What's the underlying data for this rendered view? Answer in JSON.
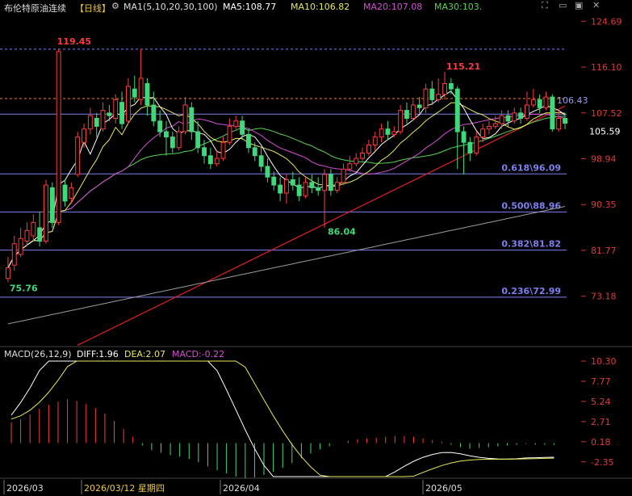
{
  "header": {
    "instrument": "布伦特原油连续",
    "period": "【日线】",
    "ma_label": "MA1(5,10,20,30,100)",
    "ma5": "MA5:108.77",
    "ma10": "MA10:106.82",
    "ma20": "MA20:107.08",
    "ma30": "MA30:103."
  },
  "macd_header": {
    "name": "MACD(26,12,9)",
    "diff": "DIFF:1.96",
    "dea": "DEA:2.07",
    "macd": "MACD:-0.22"
  },
  "colors": {
    "up": "#ff3b3b",
    "down": "#3fd87a",
    "ma5": "#ffffff",
    "ma10": "#e8e85a",
    "ma20": "#d44fd4",
    "ma30": "#55d455",
    "ma100": "#9a9a9a",
    "fib": "#7f7ff0",
    "trend": "#e02020",
    "dash": "#e08a2a"
  },
  "icons": [
    "settings-gear-icon",
    "expand-icon",
    "minimize-icon",
    "restore-icon",
    "close-icon"
  ],
  "chart_data": {
    "type": "candlestick",
    "price_axis": {
      "ticks": [
        "124.69",
        "116.10",
        "107.52",
        "98.94",
        "90.35",
        "81.77",
        "73.18"
      ],
      "current": "105.59",
      "current_ma": "106.43"
    },
    "fib_levels": [
      "0.618\\96.09",
      "0.500\\88.96",
      "0.382\\81.82",
      "0.236\\72.99"
    ],
    "price_labels": {
      "high1": "119.45",
      "high2": "115.21",
      "low1": "86.04",
      "low0": "75.76"
    },
    "dates": [
      "2026/03",
      "2026/03/12 星期四",
      "2026/04",
      "2026/05"
    ],
    "macd_axis": [
      "10.30",
      "7.77",
      "5.24",
      "2.71",
      "0.18",
      "-2.35"
    ],
    "candles": [
      [
        76.5,
        78.5,
        80.5,
        75.8
      ],
      [
        79,
        83,
        84.5,
        78
      ],
      [
        81,
        84,
        86,
        80.5
      ],
      [
        83.5,
        85.5,
        87,
        82.5
      ],
      [
        84.5,
        87,
        88.5,
        83.5
      ],
      [
        86,
        83.5,
        89,
        82.5
      ],
      [
        83.5,
        94,
        95,
        83
      ],
      [
        93.5,
        87,
        94.5,
        86
      ],
      [
        87,
        119,
        119.45,
        86.5
      ],
      [
        94,
        91,
        95,
        90
      ],
      [
        91.5,
        93.5,
        94.5,
        90.5
      ],
      [
        96,
        103,
        104,
        95.5
      ],
      [
        102,
        104.5,
        105.5,
        101
      ],
      [
        104.5,
        107,
        108.5,
        103.5
      ],
      [
        106.5,
        105,
        107.5,
        103
      ],
      [
        104.5,
        108,
        109.5,
        104
      ],
      [
        107.5,
        107,
        109,
        106
      ],
      [
        106.5,
        110,
        111,
        105.5
      ],
      [
        109.5,
        105.5,
        111.5,
        104.5
      ],
      [
        106,
        112.5,
        114,
        105.5
      ],
      [
        112,
        110.5,
        114.5,
        109.5
      ],
      [
        110,
        114,
        119.5,
        109
      ],
      [
        113,
        109,
        114,
        107
      ],
      [
        109,
        106,
        111.5,
        105
      ],
      [
        106,
        104,
        108,
        103
      ],
      [
        104,
        103,
        106,
        99.5
      ],
      [
        103,
        101,
        104,
        100
      ],
      [
        101,
        104,
        105,
        100.5
      ],
      [
        104,
        109,
        110.5,
        103.5
      ],
      [
        108.5,
        104,
        109.5,
        102.5
      ],
      [
        104,
        101,
        106,
        100
      ],
      [
        101,
        99.5,
        102.5,
        98
      ],
      [
        99.5,
        98,
        101,
        97
      ],
      [
        98,
        99,
        100.5,
        97.5
      ],
      [
        99,
        102,
        103,
        98.5
      ],
      [
        102,
        105,
        106.5,
        101.5
      ],
      [
        105,
        106,
        107,
        104.5
      ],
      [
        106,
        103.5,
        107,
        102.5
      ],
      [
        103.5,
        101,
        104.5,
        100
      ],
      [
        101,
        99.5,
        102,
        98.5
      ],
      [
        99.5,
        97.5,
        101,
        96.5
      ],
      [
        97.5,
        95.5,
        99,
        94.5
      ],
      [
        95.5,
        94,
        96.5,
        93
      ],
      [
        94,
        92.5,
        95.5,
        91
      ],
      [
        92.5,
        95,
        96,
        90.5
      ],
      [
        95,
        94,
        96.5,
        93
      ],
      [
        94,
        92,
        95.5,
        91
      ],
      [
        92,
        94.5,
        95.5,
        91.5
      ],
      [
        94.5,
        93.5,
        96,
        92.5
      ],
      [
        93.5,
        93,
        95.5,
        92
      ],
      [
        93,
        96,
        97,
        86.04
      ],
      [
        96,
        93,
        97,
        92
      ],
      [
        93,
        94.5,
        95.5,
        92.5
      ],
      [
        94.5,
        97,
        98,
        94
      ],
      [
        97,
        98,
        99.5,
        96.5
      ],
      [
        98,
        99,
        100,
        97.5
      ],
      [
        99,
        100,
        101,
        98.5
      ],
      [
        100,
        101.5,
        102.5,
        99.5
      ],
      [
        101.5,
        103,
        104,
        100.5
      ],
      [
        103,
        104.5,
        105.5,
        102
      ],
      [
        104.5,
        103.5,
        106,
        102.5
      ],
      [
        103.5,
        104,
        105,
        103
      ],
      [
        104,
        108,
        109,
        103.5
      ],
      [
        108,
        106.5,
        109.5,
        105.5
      ],
      [
        106.5,
        109,
        110,
        106
      ],
      [
        109,
        108.5,
        110.5,
        107.5
      ],
      [
        108.5,
        112,
        113,
        107.5
      ],
      [
        112,
        110,
        113.5,
        109
      ],
      [
        110,
        111,
        114,
        109.5
      ],
      [
        111,
        113,
        115.21,
        110
      ],
      [
        113,
        112,
        114,
        111
      ],
      [
        112,
        104,
        112.5,
        97
      ],
      [
        104,
        102,
        105,
        96
      ],
      [
        102,
        100,
        103,
        98.5
      ],
      [
        100,
        103,
        104,
        99.5
      ],
      [
        103,
        104.5,
        105.5,
        102
      ],
      [
        104.5,
        105,
        106,
        103.5
      ],
      [
        105,
        105.5,
        107,
        104.5
      ],
      [
        105.5,
        107,
        108,
        104.5
      ],
      [
        107,
        106,
        108,
        105
      ],
      [
        106,
        107.5,
        108.5,
        105.5
      ],
      [
        107.5,
        106.5,
        108.5,
        105.5
      ],
      [
        106.5,
        109,
        111.5,
        106
      ],
      [
        109,
        110,
        112,
        108.5
      ],
      [
        110,
        108.5,
        111,
        107.5
      ],
      [
        108.5,
        110.5,
        111.5,
        108
      ],
      [
        110.5,
        104.5,
        111,
        104
      ],
      [
        104.5,
        106.5,
        108,
        104
      ],
      [
        106.5,
        105.59,
        107.5,
        104.5
      ]
    ],
    "macd_hist": [
      2.6,
      3.0,
      3.6,
      4.3,
      4.8,
      5.2,
      5.5,
      5.3,
      4.9,
      4.4,
      3.7,
      2.8,
      1.8,
      0.8,
      -0.3,
      -0.9,
      -1.2,
      -1.5,
      -1.7,
      -2.0,
      -2.4,
      -2.9,
      -3.4,
      -3.8,
      -4.2,
      -4.4,
      -4.3,
      -4.0,
      -3.6,
      -3.1,
      -2.5,
      -1.9,
      -1.3,
      -0.8,
      -0.4,
      0.0,
      0.3,
      0.5,
      0.6,
      0.7,
      0.8,
      0.9,
      0.9,
      0.8,
      0.6,
      0.4,
      0.2,
      -0.2,
      -0.5,
      -0.7,
      -0.6,
      -0.5,
      -0.4,
      -0.3,
      -0.2,
      -0.1,
      -0.2,
      -0.2,
      -0.22
    ]
  }
}
